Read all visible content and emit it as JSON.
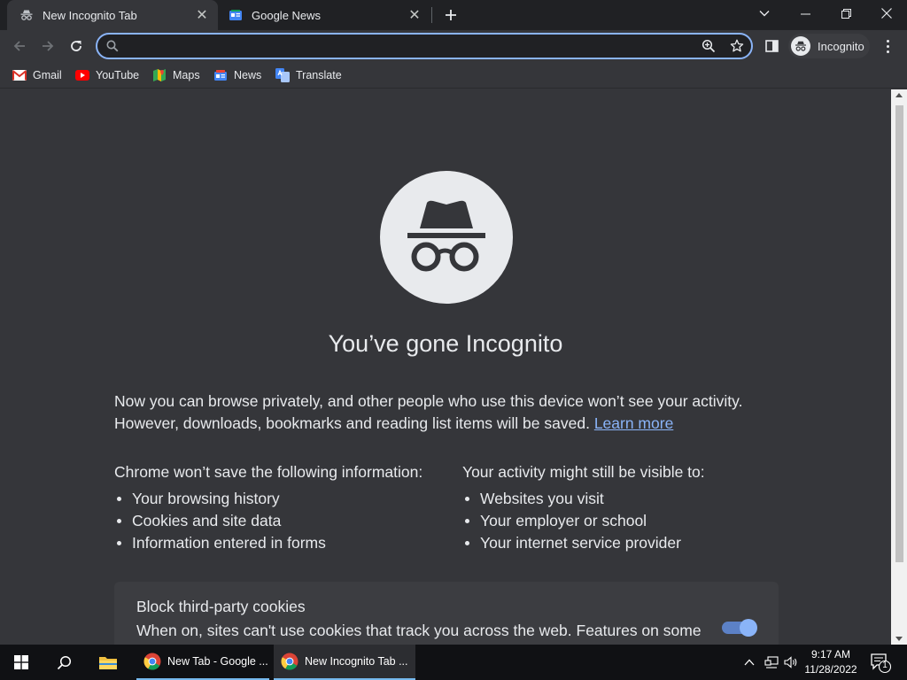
{
  "tabs": [
    {
      "title": "New Incognito Tab",
      "close": "✕",
      "active": true
    },
    {
      "title": "Google News",
      "close": "✕",
      "active": false
    }
  ],
  "tab_strip": {
    "new_tab_symbol": "+"
  },
  "window_controls": {
    "minimize": "—",
    "restore": "❐",
    "close": "✕"
  },
  "omnibox": {
    "value": "",
    "placeholder": ""
  },
  "profile": {
    "label": "Incognito"
  },
  "bookmarks": [
    {
      "label": "Gmail",
      "icon": "gmail-icon"
    },
    {
      "label": "YouTube",
      "icon": "youtube-icon"
    },
    {
      "label": "Maps",
      "icon": "maps-icon"
    },
    {
      "label": "News",
      "icon": "news-icon"
    },
    {
      "label": "Translate",
      "icon": "translate-icon"
    }
  ],
  "page": {
    "heading": "You’ve gone Incognito",
    "intro_line1": "Now you can browse privately, and other people who use this device won’t see your activity.",
    "intro_line2": "However, downloads, bookmarks and reading list items will be saved.",
    "learn_more": "Learn more",
    "left_column": {
      "heading": "Chrome won’t save the following information:",
      "items": [
        "Your browsing history",
        "Cookies and site data",
        "Information entered in forms"
      ]
    },
    "right_column": {
      "heading": "Your activity might still be visible to:",
      "items": [
        "Websites you visit",
        "Your employer or school",
        "Your internet service provider"
      ]
    },
    "cookie_card": {
      "title": "Block third-party cookies",
      "description": "When on, sites can't use cookies that track you across the web. Features on some",
      "toggle_on": true
    }
  },
  "taskbar": {
    "apps": [
      {
        "label": "New Tab - Google ...",
        "icon": "chrome-icon",
        "active": false
      },
      {
        "label": "New Incognito Tab ...",
        "icon": "chrome-icon",
        "active": true
      }
    ],
    "time": "9:17 AM",
    "date": "11/28/2022",
    "notification_count": "1"
  },
  "colors": {
    "page_bg": "#35363a",
    "tabstrip_bg": "#202124",
    "accent": "#8ab4f8",
    "text": "#e8eaed",
    "taskbar_bg": "#101114"
  }
}
